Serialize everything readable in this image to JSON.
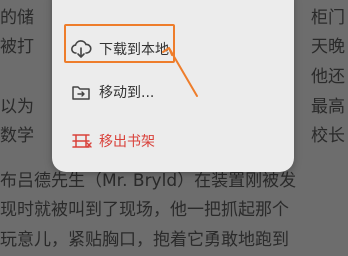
{
  "background_text": [
    "的储",
    "被打",
    "以为",
    "数学",
    "布吕德先生（Mr. Bryld）在装置刚被发",
    "现时就被叫到了现场，他一把抓起那个",
    "玩意儿，紧贴胸口，抱着它勇敢地跑到"
  ],
  "background_text_right": [
    "柜门",
    "天晚",
    "他还",
    "最高",
    "校长"
  ],
  "menu": {
    "items": [
      {
        "label": "下载到本地",
        "icon": "cloud-download-icon"
      },
      {
        "label": "移动到...",
        "icon": "folder-move-icon"
      },
      {
        "label": "移出书架",
        "icon": "bookshelf-remove-icon"
      }
    ]
  },
  "colors": {
    "highlight": "#ee7d2b",
    "danger": "#d9413a",
    "menu_bg": "#ececec",
    "overlay_bg": "#6d6d6d"
  }
}
